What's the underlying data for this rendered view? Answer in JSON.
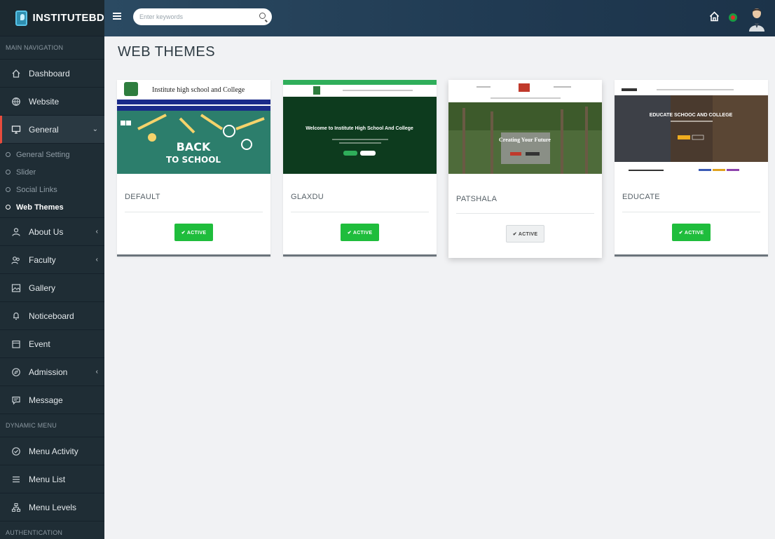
{
  "app": {
    "brand": "INSTITUTEBD"
  },
  "topbar": {
    "search_placeholder": "Enter keywords"
  },
  "sidebar": {
    "main_header": "MAIN NAVIGATION",
    "dashboard": "Dashboard",
    "website": "Website",
    "general": "General",
    "general_sub": [
      "General Setting",
      "Slider",
      "Social Links",
      "Web Themes"
    ],
    "about": "About Us",
    "faculty": "Faculty",
    "gallery": "Gallery",
    "noticeboard": "Noticeboard",
    "event": "Event",
    "admission": "Admission",
    "message": "Message",
    "dynamic_header": "DYNAMIC MENU",
    "menu_activity": "Menu Activity",
    "menu_list": "Menu List",
    "menu_levels": "Menu Levels",
    "auth_header": "AUTHENTICATION"
  },
  "page": {
    "title": "WEB THEMES"
  },
  "themes": [
    {
      "name": "DEFAULT",
      "button": "✔ ACTIVE",
      "state": "active",
      "preview": {
        "header_title": "Institute high school and College",
        "banner_line1": "BACK",
        "banner_line2": "TO SCHOOL"
      }
    },
    {
      "name": "GLAXDU",
      "button": "✔ ACTIVE",
      "state": "active",
      "preview": {
        "heading": "Welcome to Institute High School And College"
      }
    },
    {
      "name": "PATSHALA",
      "button": "✔ ACTIVE",
      "state": "inactive",
      "preview": {
        "heading": "Creating Your Future"
      }
    },
    {
      "name": "EDUCATE",
      "button": "✔ ACTIVE",
      "state": "active",
      "preview": {
        "heading": "EDUCATE SCHOOC AND COLLEGE"
      }
    }
  ],
  "colors": {
    "active_button": "#1fbd3c",
    "sidebar_bg": "#1f2d35",
    "topbar_bg": "#203a52",
    "accent_red": "#e84c3d"
  }
}
